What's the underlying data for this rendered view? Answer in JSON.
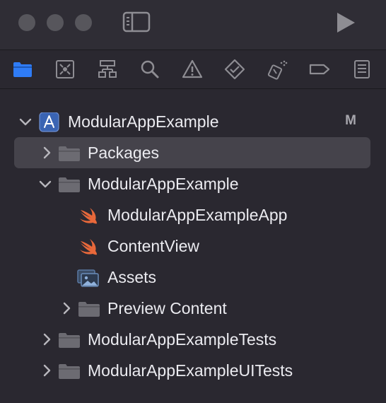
{
  "window": {
    "traffic_lights": [
      "close",
      "minimize",
      "zoom"
    ],
    "sidebar_toggle_icon": "sidebar-icon",
    "run_icon": "play-icon"
  },
  "navigator_tabs": [
    {
      "icon": "folder-icon",
      "active": true
    },
    {
      "icon": "source-control-icon",
      "active": false
    },
    {
      "icon": "hierarchy-icon",
      "active": false
    },
    {
      "icon": "search-icon",
      "active": false
    },
    {
      "icon": "warning-icon",
      "active": false
    },
    {
      "icon": "test-icon",
      "active": false
    },
    {
      "icon": "debug-icon",
      "active": false
    },
    {
      "icon": "breakpoint-icon",
      "active": false
    },
    {
      "icon": "report-icon",
      "active": false
    }
  ],
  "tree": {
    "project": {
      "label": "ModularAppExample",
      "badge": "M",
      "icon": "xcode-project-icon",
      "expanded": true
    },
    "items": [
      {
        "label": "Packages",
        "icon": "folder-icon",
        "expanded": false,
        "selected": true
      },
      {
        "label": "ModularAppExample",
        "icon": "folder-icon",
        "expanded": true
      },
      {
        "label": "ModularAppExampleApp",
        "icon": "swift-icon"
      },
      {
        "label": "ContentView",
        "icon": "swift-icon"
      },
      {
        "label": "Assets",
        "icon": "asset-catalog-icon"
      },
      {
        "label": "Preview Content",
        "icon": "folder-icon",
        "expanded": false
      },
      {
        "label": "ModularAppExampleTests",
        "icon": "folder-icon",
        "expanded": false
      },
      {
        "label": "ModularAppExampleUITests",
        "icon": "folder-icon",
        "expanded": false
      }
    ]
  },
  "colors": {
    "background": "#2a2830",
    "selection": "#45434b",
    "accent": "#2f7cf6",
    "swift": "#e8683a"
  }
}
